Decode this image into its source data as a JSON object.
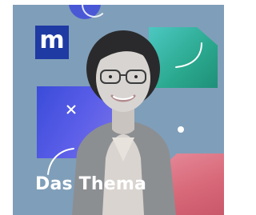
{
  "cover": {
    "logo_letter": "m",
    "title": "Das Thema"
  },
  "colors": {
    "background": "#7f9eb9",
    "logo_bg": "#1f3aa3",
    "teal_shape": "#2aa88e",
    "blue_shape": "#4a58d6",
    "pink_shape": "#d86979",
    "title_text": "#ffffff"
  },
  "icons": {
    "logo": "m-logo",
    "portrait": "portrait-photo",
    "decor": [
      "x-mark-icon",
      "arc-icon",
      "dot-icon",
      "ring-icon"
    ]
  }
}
